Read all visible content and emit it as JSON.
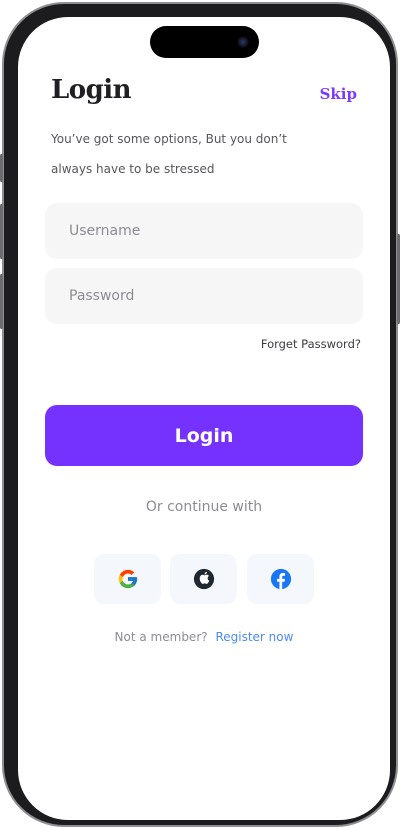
{
  "header": {
    "title": "Login",
    "skip_label": "Skip",
    "subtitle": "You’ve got some options, But you don’t always have to be stressed"
  },
  "form": {
    "username_placeholder": "Username",
    "password_placeholder": "Password",
    "forget_password": "Forget Password?",
    "login_label": "Login"
  },
  "social": {
    "divider_label": "Or continue with",
    "providers": [
      {
        "name": "google-icon"
      },
      {
        "name": "apple-icon"
      },
      {
        "name": "facebook-icon"
      }
    ]
  },
  "footer": {
    "prompt": "Not a member?",
    "register_label": "Register now"
  },
  "colors": {
    "accent": "#7532ff",
    "skip": "#7b3cff",
    "link": "#4c8bf5",
    "field_bg": "#f6f6f7"
  }
}
